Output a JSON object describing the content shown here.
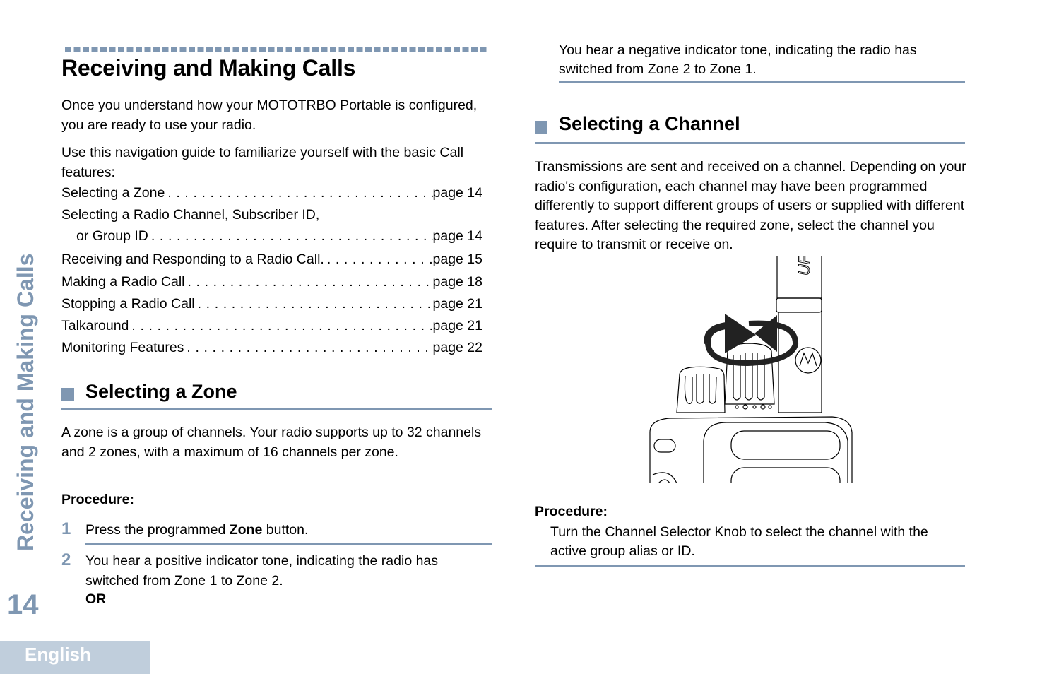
{
  "page": {
    "section_title": "Receiving and Making Calls",
    "sidebar_title": "Receiving and Making Calls",
    "page_number": "14",
    "language_tab": "English",
    "accent_color": "#7f97b2"
  },
  "left": {
    "intro_1": "Once you understand how your MOTOTRBO Portable is configured, you are ready to use your radio.",
    "intro_2": "Use this navigation guide to familiarize yourself with the basic Call features:",
    "toc": [
      {
        "label": "Selecting a Zone",
        "page": "page 14"
      },
      {
        "label_line1": "Selecting a Radio Channel, Subscriber ID,",
        "label_line2": "or Group ID",
        "page": "page 14"
      },
      {
        "label": "Receiving and Responding to a Radio Call.",
        "page": "page 15"
      },
      {
        "label": "Making a Radio Call",
        "page": "page 18"
      },
      {
        "label": "Stopping a Radio Call",
        "page": "page 21"
      },
      {
        "label": "Talkaround",
        "page": "page 21"
      },
      {
        "label": "Monitoring Features",
        "page": "page 22"
      }
    ],
    "zone_section": {
      "heading": "Selecting a Zone",
      "body": "A zone is a group of channels. Your radio supports up to 32 channels and 2 zones, with a maximum of 16 channels per zone.",
      "procedure_label": "Procedure:",
      "steps": [
        {
          "number": "1",
          "text_before": "Press the programmed ",
          "bold": "Zone",
          "text_after": " button."
        },
        {
          "number": "2",
          "text": "You hear a positive indicator tone, indicating the radio has switched from Zone 1 to Zone 2.",
          "or_label": "OR"
        }
      ]
    }
  },
  "right": {
    "zone_continuation": "You hear a negative indicator tone, indicating the radio has switched from Zone 2 to Zone 1.",
    "channel_section": {
      "heading": "Selecting a Channel",
      "body": "Transmissions are sent and received on a channel. Depending on your radio's configuration, each channel may have been programmed differently to support different groups of users or supplied with different features. After selecting the required zone, select the channel you require to transmit or receive on.",
      "illustration": "radio-channel-knob-rotation",
      "procedure_label": "Procedure:",
      "procedure_text": "Turn the Channel Selector Knob to select the channel with the active group alias or ID."
    }
  }
}
